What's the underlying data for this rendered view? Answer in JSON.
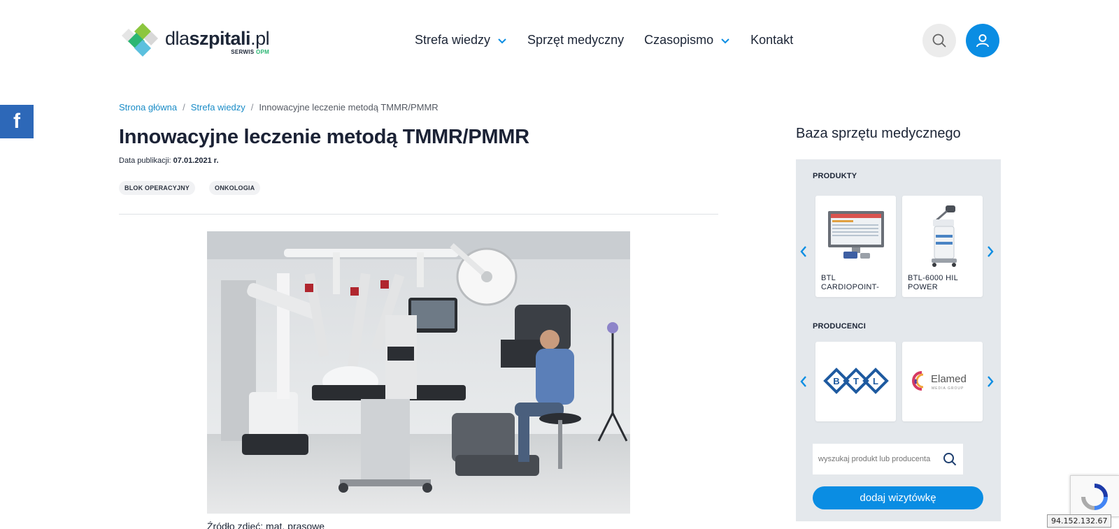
{
  "header": {
    "logo": {
      "word_light": "dla",
      "word_bold": "szpitali",
      "word_tld": ".pl",
      "sub_prefix": "SERWIS ",
      "sub_brand": "OPM"
    },
    "nav": [
      {
        "label": "Strefa wiedzy",
        "has_dropdown": true
      },
      {
        "label": "Sprzęt medyczny",
        "has_dropdown": false
      },
      {
        "label": "Czasopismo",
        "has_dropdown": true
      },
      {
        "label": "Kontakt",
        "has_dropdown": false
      }
    ],
    "accent_color": "#0a8de3"
  },
  "social": {
    "facebook_label": "f"
  },
  "breadcrumb": {
    "items": [
      "Strona główna",
      "Strefa wiedzy"
    ],
    "separator": "/",
    "current": "Innowacyjne leczenie metodą TMMR/PMMR"
  },
  "article": {
    "title": "Innowacyjne leczenie metodą TMMR/PMMR",
    "date_label": "Data publikacji: ",
    "date_value": "07.01.2021 r.",
    "tags": [
      "BLOK OPERACYJNY",
      "ONKOLOGIA"
    ],
    "caption": "Źródło zdjęć: mat. prasowe"
  },
  "sidebar": {
    "title": "Baza sprzętu medycznego",
    "products_label": "PRODUKTY",
    "products": [
      {
        "name": "BTL CARDIOPOINT-"
      },
      {
        "name": "BTL-6000 HIL POWER"
      }
    ],
    "producers_label": "PRODUCENCI",
    "producers": [
      {
        "name": "BTL"
      },
      {
        "name": "Elamed",
        "sub": "MEDIA GROUP"
      }
    ],
    "search_placeholder": "wyszukaj produkt lub producenta",
    "add_button": "dodaj wizytówkę"
  },
  "overlay": {
    "ip": "94.152.132.67"
  }
}
